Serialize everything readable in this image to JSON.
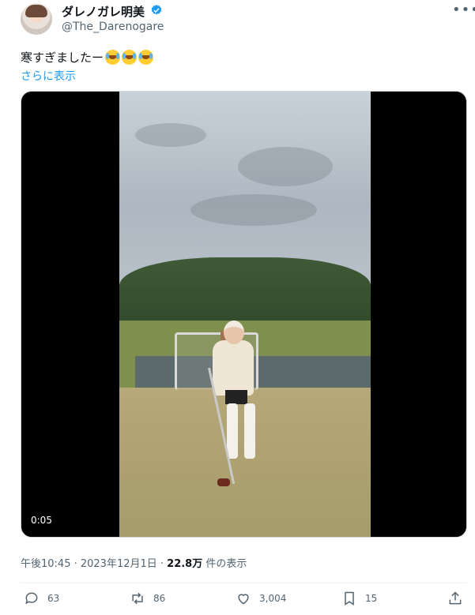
{
  "user": {
    "name": "ダレノガレ明美",
    "handle": "@The_Darenogare"
  },
  "tweet": {
    "text": "寒すぎましたー",
    "emoji_count": 3,
    "show_more": "さらに表示"
  },
  "video": {
    "time": "0:05"
  },
  "meta": {
    "datetime": "午後10:45 · 2023年12月1日 · ",
    "views_count": "22.8万",
    "views_label": " 件の表示"
  },
  "actions": {
    "reply_count": "63",
    "retweet_count": "86",
    "like_count": "3,004",
    "bookmark_count": "15"
  },
  "colors": {
    "accent": "#1d9bf0",
    "secondary_text": "#536471"
  },
  "icons": [
    "verified-badge-icon",
    "more-icon",
    "reply-icon",
    "retweet-icon",
    "like-icon",
    "bookmark-icon",
    "share-icon"
  ]
}
